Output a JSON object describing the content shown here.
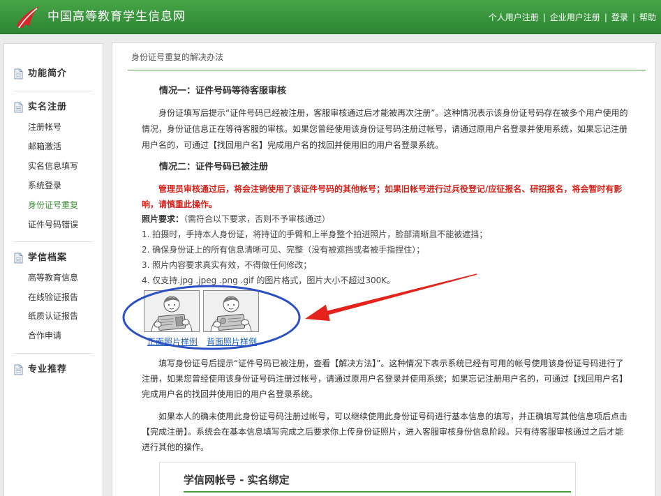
{
  "header": {
    "site_title": "中国高等教育学生信息网",
    "nav": [
      {
        "label": "个人用户注册"
      },
      {
        "label": "企业用户注册"
      },
      {
        "label": "登录"
      },
      {
        "label": "帮助"
      }
    ],
    "separator": "|"
  },
  "sidebar": {
    "sections": [
      {
        "title": "功能简介",
        "items": []
      },
      {
        "title": "实名注册",
        "items": [
          {
            "label": "注册帐号",
            "active": false
          },
          {
            "label": "邮箱激活",
            "active": false
          },
          {
            "label": "实名信息填写",
            "active": false
          },
          {
            "label": "系统登录",
            "active": false
          },
          {
            "label": "身份证号重复",
            "active": true
          },
          {
            "label": "证件号码错误",
            "active": false
          }
        ]
      },
      {
        "title": "学信档案",
        "items": [
          {
            "label": "高等教育信息",
            "active": false
          },
          {
            "label": "在线验证报告",
            "active": false
          },
          {
            "label": "纸质认证报告",
            "active": false
          },
          {
            "label": "合作申请",
            "active": false
          }
        ]
      },
      {
        "title": "专业推荐",
        "items": []
      }
    ]
  },
  "main": {
    "page_title": "身份证号重复的解决办法",
    "case1": {
      "heading": "情况一：证件号码等待客服审核",
      "text": "身份证填写后提示“证件号码已经被注册，客服审核通过后才能被再次注册”。这种情况表示该身份证号码存在被多个用户使用的情况，身份证信息正在等待客服的审核。如果您曾经使用该身份证号码注册过帐号，请通过原用户名登录并使用系统，如果忘记注册用户名的，可通过【找回用户名】完成用户名的找回并使用旧的用户名登录系统。"
    },
    "case2": {
      "heading": "情况二：证件号码已被注册",
      "warning": "管理员审核通过后，将会注销使用了该证件号码的其他帐号；如果旧帐号进行过兵役登记/应征报名、研招报名，将会暂时有影响，请慎重此操作。",
      "photo_requirements": {
        "label": "照片要求：",
        "note": "（需符合以下要求，否则不予审核通过）",
        "items": [
          "1. 拍摄时，手持本人身份证，将持证的手臂和上半身整个拍进照片，脸部清晰且不能被遮挡；",
          "2. 确保身份证上的所有信息清晰可见、完整（没有被遮挡或者被手指捏住）；",
          "3. 照片内容要求真实有效，不得做任何修改；",
          "4. 仅支持.jpg .jpeg .png .gif 的图片格式，图片大小不超过300K。"
        ]
      },
      "samples": [
        {
          "caption": "正面照片样例",
          "icon": "id-photo-front-icon"
        },
        {
          "caption": "背面照片样例",
          "icon": "id-photo-back-icon"
        }
      ],
      "paragraphs": [
        "填写身份证号后提示“证件号码已被注册，查看【解决方法】”。这种情况下表示系统已经有可用的帐号使用该身份证号码进行了注册，如果您曾经使用该身份证号码注册过帐号，请通过原用户名登录并使用系统；如果忘记注册用户名的，可通过【找回用户名】完成用户名的找回并使用旧的用户名登录系统。",
        "如果本人的确未使用此身份证号码注册过帐号，可以继续使用此身份证号码进行基本信息的填写，并正确填写其他信息项后点击【完成注册】。系统会在基本信息填写完成之后要求你上传身份证照片，进入客服审核身份信息阶段。只有待客服审核通过之后才能进行其他的操作。"
      ]
    },
    "binding_panel": {
      "title": "学信网帐号 - 实名绑定"
    }
  },
  "icons": {
    "logo": "chsi-logo-icon",
    "section": "document-icon"
  },
  "colors": {
    "header_green": "#2f8a35",
    "accent_green": "#3d8b37",
    "warning_red": "#d4231b",
    "link_blue": "#1f5fbf",
    "annotation_ellipse": "#2b4fc4",
    "annotation_arrow": "#e5231c"
  }
}
